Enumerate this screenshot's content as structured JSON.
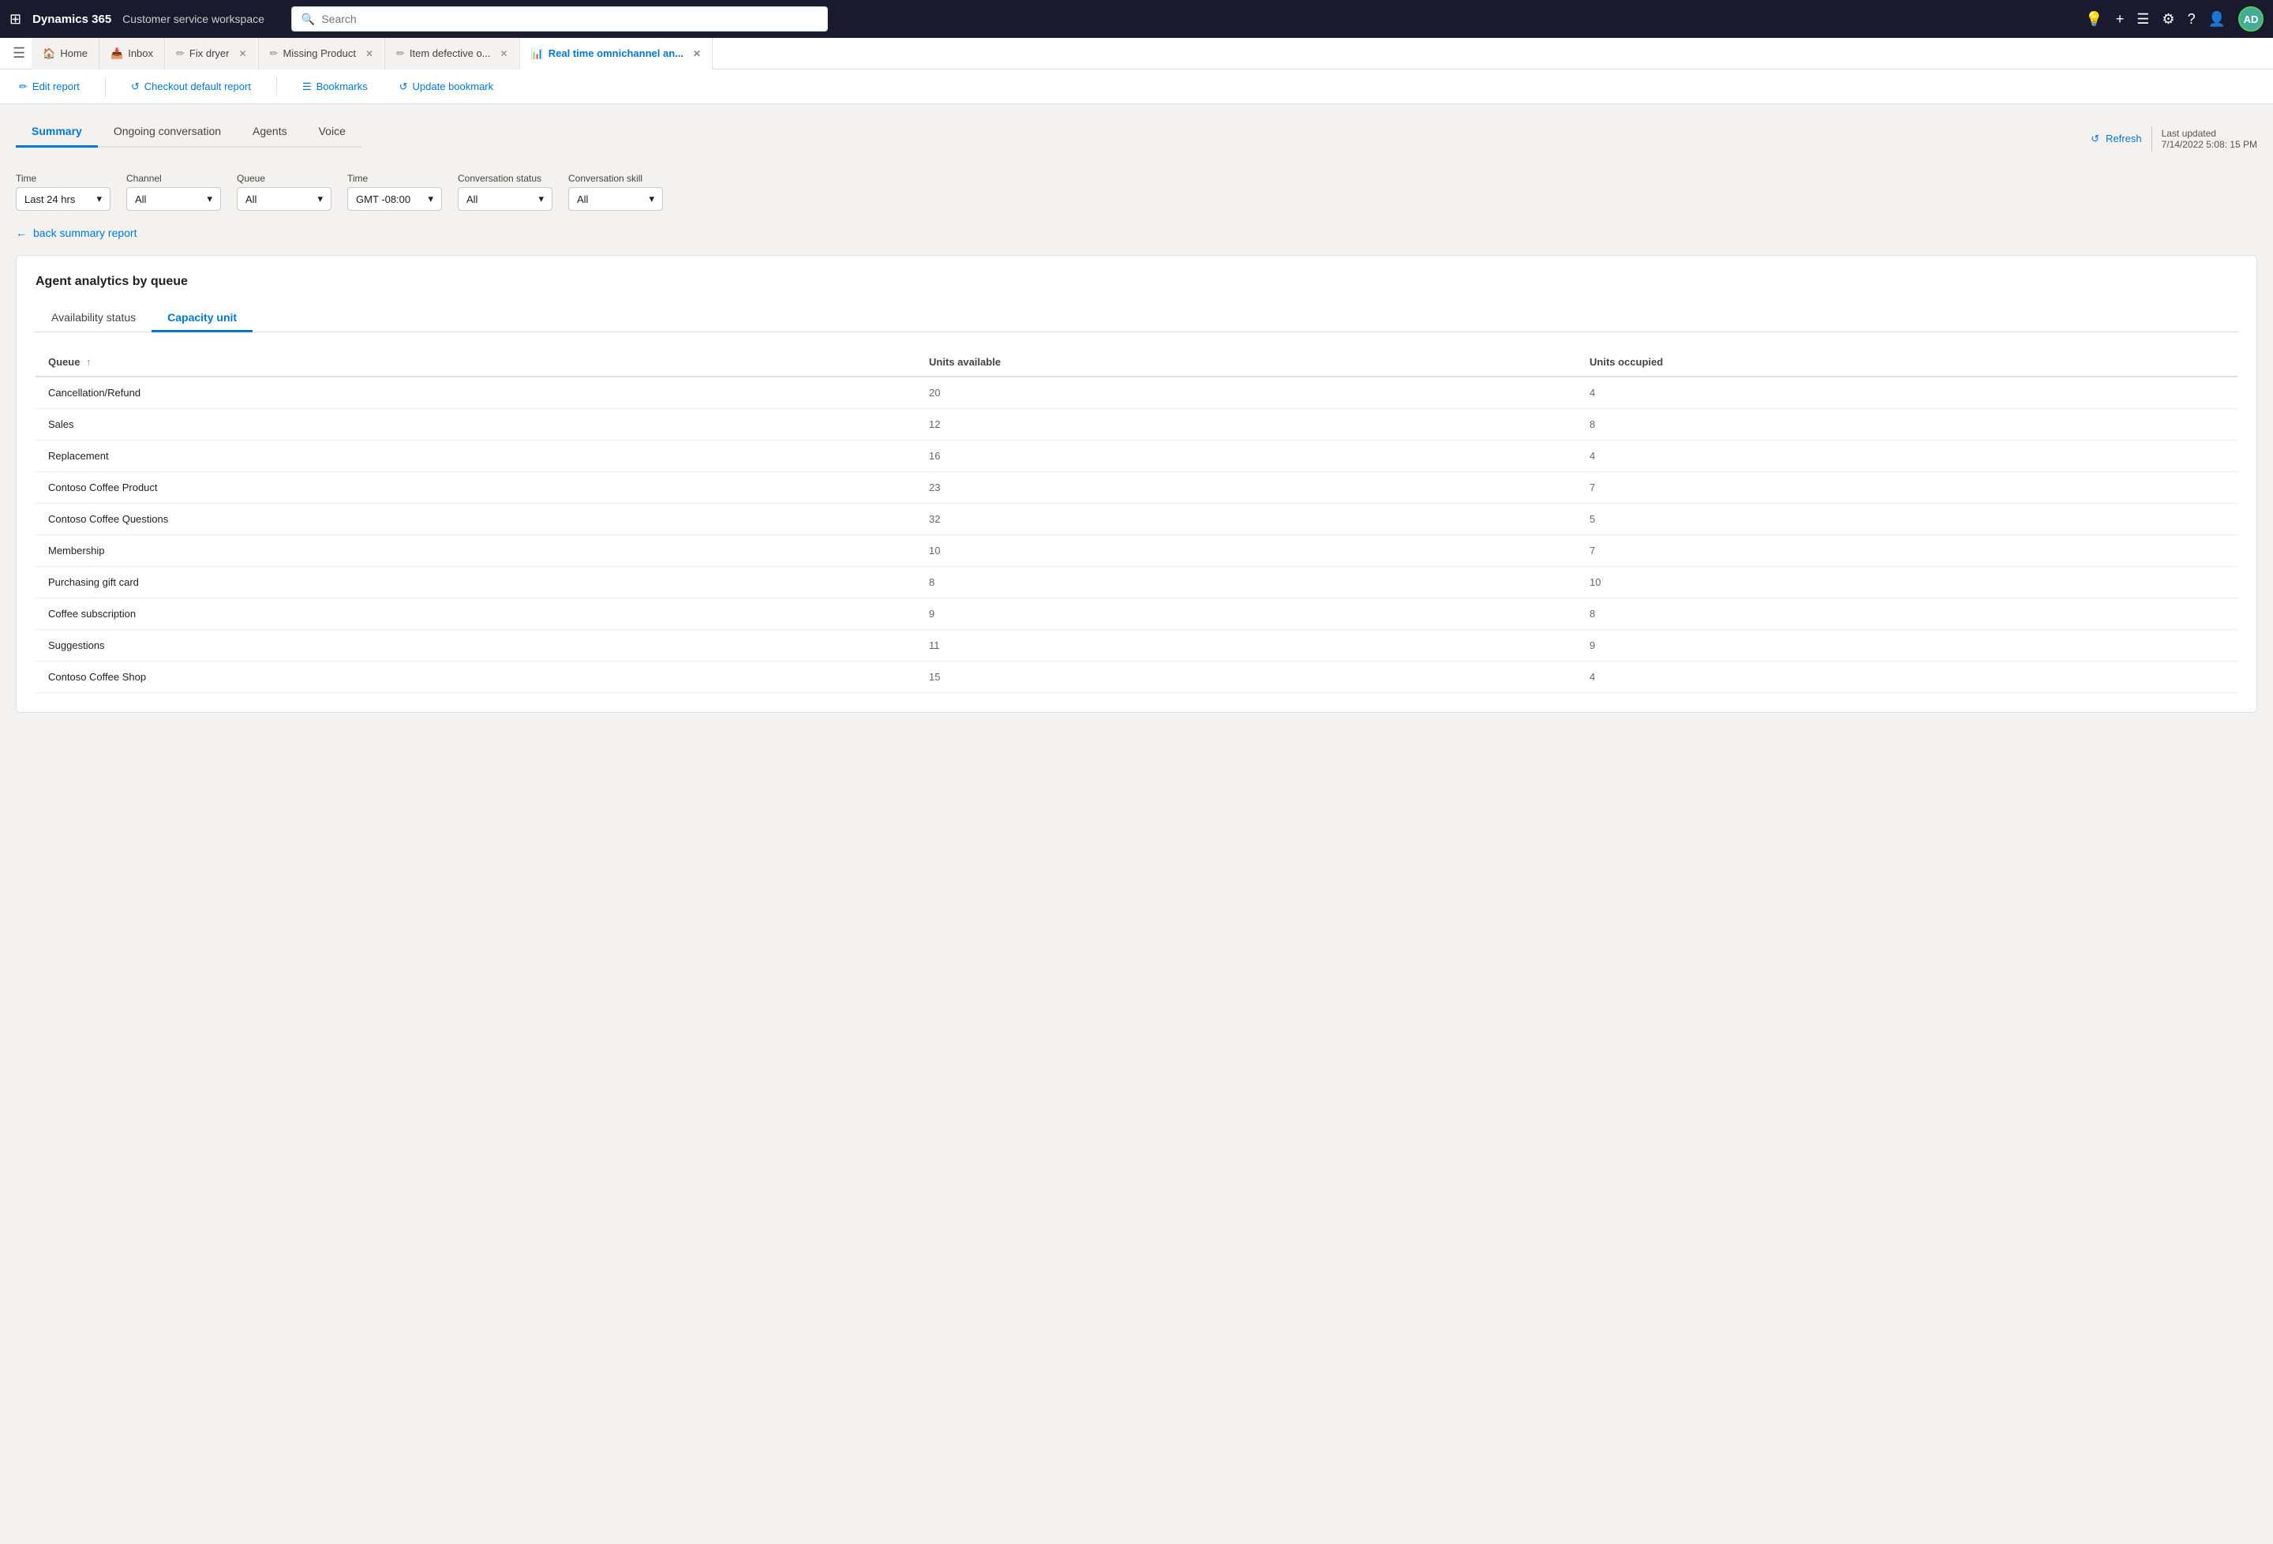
{
  "topNav": {
    "appIcon": "⊞",
    "appTitle": "Dynamics 365",
    "appSubtitle": "Customer service workspace",
    "searchPlaceholder": "Search",
    "navIcons": [
      "💡",
      "+",
      "≡",
      "⚙",
      "?",
      "👤"
    ],
    "avatarInitials": "AD"
  },
  "tabBar": {
    "menuIcon": "☰",
    "tabs": [
      {
        "id": "home",
        "icon": "🏠",
        "label": "Home",
        "active": false,
        "closable": false
      },
      {
        "id": "inbox",
        "icon": "📥",
        "label": "Inbox",
        "active": false,
        "closable": false
      },
      {
        "id": "fix-dryer",
        "icon": "✏",
        "label": "Fix dryer",
        "active": false,
        "closable": true
      },
      {
        "id": "missing-product",
        "icon": "✏",
        "label": "Missing Product",
        "active": false,
        "closable": true
      },
      {
        "id": "item-defective",
        "icon": "✏",
        "label": "Item defective o...",
        "active": false,
        "closable": true
      },
      {
        "id": "real-time",
        "icon": "📊",
        "label": "Real time omnichannel an...",
        "active": true,
        "closable": true
      }
    ]
  },
  "toolbar": {
    "editReportLabel": "Edit report",
    "checkoutLabel": "Checkout default report",
    "bookmarksLabel": "Bookmarks",
    "updateBookmarkLabel": "Update bookmark"
  },
  "reportTabs": [
    {
      "id": "summary",
      "label": "Summary",
      "active": true
    },
    {
      "id": "ongoing-conversation",
      "label": "Ongoing conversation",
      "active": false
    },
    {
      "id": "agents",
      "label": "Agents",
      "active": false
    },
    {
      "id": "voice",
      "label": "Voice",
      "active": false
    }
  ],
  "refreshArea": {
    "refreshLabel": "Refresh",
    "lastUpdatedLabel": "Last updated",
    "lastUpdatedValue": "7/14/2022 5:08: 15 PM"
  },
  "filters": [
    {
      "label": "Time",
      "value": "Last 24 hrs",
      "id": "time-filter"
    },
    {
      "label": "Channel",
      "value": "All",
      "id": "channel-filter"
    },
    {
      "label": "Queue",
      "value": "All",
      "id": "queue-filter"
    },
    {
      "label": "Time",
      "value": "GMT -08:00",
      "id": "timezone-filter"
    },
    {
      "label": "Conversation status",
      "value": "All",
      "id": "conv-status-filter"
    },
    {
      "label": "Conversation skill",
      "value": "All",
      "id": "conv-skill-filter"
    }
  ],
  "backLink": "back summary report",
  "card": {
    "title": "Agent analytics by queue",
    "subtabs": [
      {
        "id": "availability",
        "label": "Availability status",
        "active": false
      },
      {
        "id": "capacity",
        "label": "Capacity unit",
        "active": true
      }
    ],
    "table": {
      "columns": [
        {
          "id": "queue",
          "label": "Queue",
          "sortable": true
        },
        {
          "id": "units-available",
          "label": "Units available",
          "sortable": false
        },
        {
          "id": "units-occupied",
          "label": "Units occupied",
          "sortable": false
        }
      ],
      "rows": [
        {
          "queue": "Cancellation/Refund",
          "unitsAvailable": "20",
          "unitsOccupied": "4"
        },
        {
          "queue": "Sales",
          "unitsAvailable": "12",
          "unitsOccupied": "8"
        },
        {
          "queue": "Replacement",
          "unitsAvailable": "16",
          "unitsOccupied": "4"
        },
        {
          "queue": "Contoso Coffee Product",
          "unitsAvailable": "23",
          "unitsOccupied": "7"
        },
        {
          "queue": "Contoso Coffee Questions",
          "unitsAvailable": "32",
          "unitsOccupied": "5"
        },
        {
          "queue": "Membership",
          "unitsAvailable": "10",
          "unitsOccupied": "7"
        },
        {
          "queue": "Purchasing gift card",
          "unitsAvailable": "8",
          "unitsOccupied": "10"
        },
        {
          "queue": "Coffee subscription",
          "unitsAvailable": "9",
          "unitsOccupied": "8"
        },
        {
          "queue": "Suggestions",
          "unitsAvailable": "11",
          "unitsOccupied": "9"
        },
        {
          "queue": "Contoso Coffee Shop",
          "unitsAvailable": "15",
          "unitsOccupied": "4"
        }
      ]
    }
  }
}
